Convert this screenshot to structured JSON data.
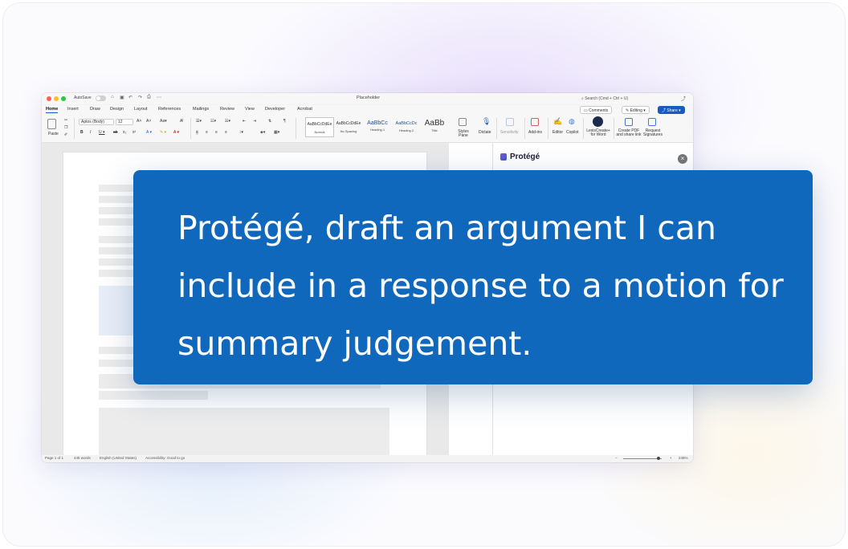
{
  "word": {
    "title": "Placeholder",
    "autosave_label": "AutoSave",
    "search_placeholder": "Search (Cmd + Ctrl + U)",
    "tabs": [
      "Home",
      "Insert",
      "Draw",
      "Design",
      "Layout",
      "References",
      "Mailings",
      "Review",
      "View",
      "Developer",
      "Acrobat"
    ],
    "comments_label": "Comments",
    "editing_label": "Editing",
    "share_label": "Share",
    "ribbon": {
      "paste": "Paste",
      "font": "Aptos (Body)",
      "size": "12",
      "styles": [
        {
          "sample": "AaBbCcDdEe",
          "name": "Normal"
        },
        {
          "sample": "AaBbCcDdEe",
          "name": "No Spacing"
        },
        {
          "sample": "AaBbCc",
          "name": "Heading 1"
        },
        {
          "sample": "AaBbCcDc",
          "name": "Heading 2"
        },
        {
          "sample": "AaBb",
          "name": "Title"
        }
      ],
      "styles_pane": "Styles Pane",
      "dictate": "Dictate",
      "sensitivity": "Sensitivity",
      "addins": "Add-ins",
      "editor": "Editor",
      "copilot": "Copilot",
      "lexis": "LexisCreate+ for Word",
      "create_pdf": "Create PDF and share link",
      "request_sig": "Request Signatures"
    },
    "sidebar": {
      "brand": "Protégé"
    },
    "status": {
      "page": "Page 1 of 1",
      "words": "445 words",
      "language": "English (United States)",
      "accessibility": "Accessibility: Good to go",
      "zoom": "246%"
    }
  },
  "prompt": {
    "text": "Protégé, draft an argument I can include in a response to a motion for summary judgement."
  },
  "colors": {
    "prompt_bg": "#1068bc",
    "word_accent": "#185abd"
  }
}
